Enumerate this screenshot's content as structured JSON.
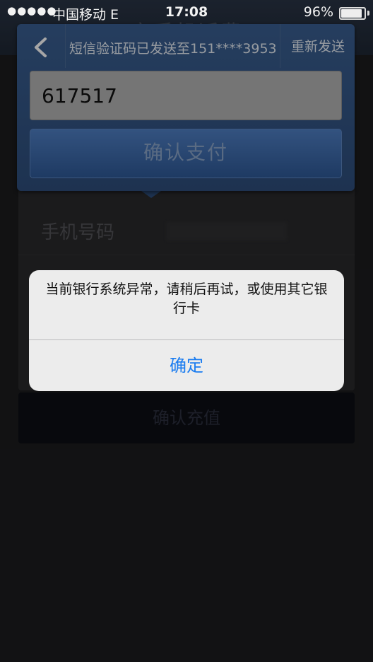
{
  "status_bar": {
    "signal": "●●●●●",
    "carrier": "中国移动  E",
    "time": "17:08",
    "battery": "96%",
    "battery_level": 0.96
  },
  "background": {
    "nav_title": "充手机话费",
    "phone_label": "手机号码",
    "confirm_button": "确认充值"
  },
  "sms_panel": {
    "header_text": "短信验证码已发送至151****3953",
    "resend_label": "重新发送",
    "code_value": "617517",
    "pay_button": "确认支付"
  },
  "alert": {
    "message": "当前银行系统异常，请稍后再试，或使用其它银行卡",
    "ok_button": "确定"
  }
}
